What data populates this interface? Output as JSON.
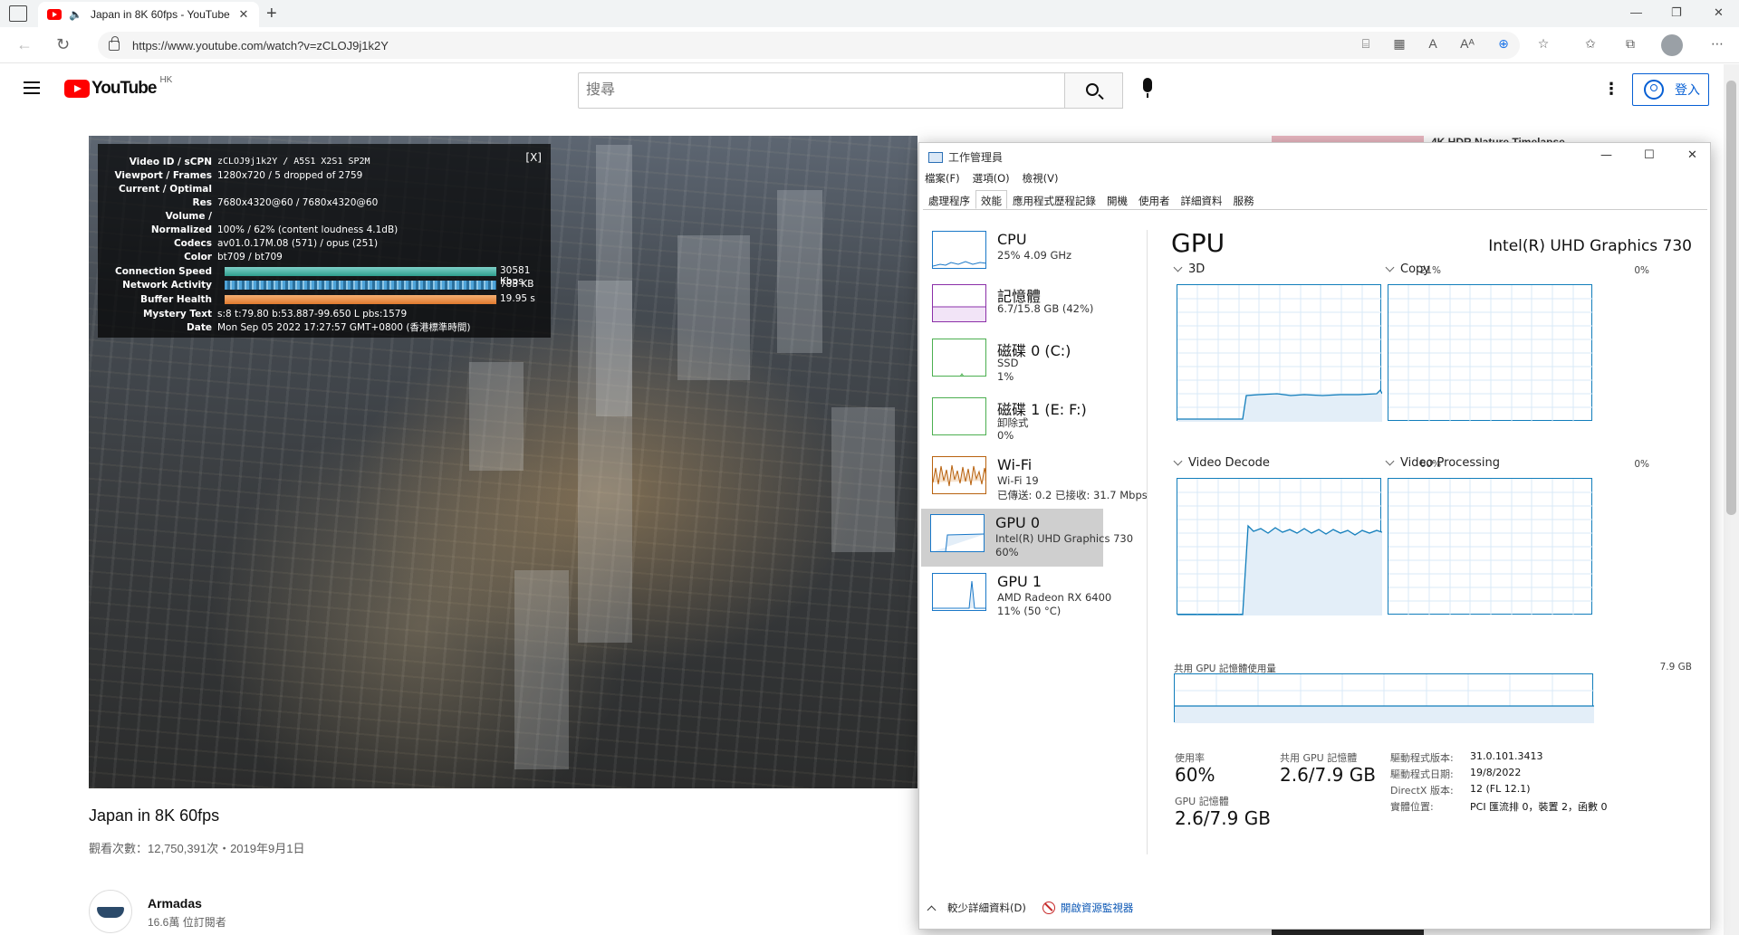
{
  "browser": {
    "tab_title": "Japan in 8K 60fps - YouTube",
    "url": "https://www.youtube.com/watch?v=zCLOJ9j1k2Y"
  },
  "youtube": {
    "logo_text": "YouTube",
    "country": "HK",
    "search_placeholder": "搜尋",
    "signin_label": "登入",
    "video": {
      "title": "Japan in 8K 60fps",
      "meta": "觀看次數：12,750,391次・2019年9月1日",
      "channel": "Armadas",
      "subscribers": "16.6萬 位訂閱者"
    },
    "related_title": "4K HDR Nature Timelapse"
  },
  "stats_for_nerds": {
    "close": "[X]",
    "rows": [
      {
        "k": "Video ID / sCPN",
        "v": "zCLOJ9j1k2Y / A5S1 X2S1 SP2M"
      },
      {
        "k": "Viewport / Frames",
        "v": "1280x720 / 5 dropped of 2759"
      },
      {
        "k": "Current / Optimal",
        "v": ""
      },
      {
        "k": "Res",
        "v": "7680x4320@60 / 7680x4320@60"
      },
      {
        "k": "Volume /",
        "v": ""
      },
      {
        "k": "Normalized",
        "v": "100% / 62% (content loudness 4.1dB)"
      },
      {
        "k": "Codecs",
        "v": "av01.0.17M.08 (571) / opus (251)"
      },
      {
        "k": "Color",
        "v": "bt709 / bt709"
      },
      {
        "k": "Connection Speed",
        "v": ""
      },
      {
        "k": "Network Activity",
        "v": ""
      },
      {
        "k": "Buffer Health",
        "v": ""
      },
      {
        "k": "Mystery Text",
        "v": "s:8 t:79.80 b:53.887-99.650 L pbs:1579"
      },
      {
        "k": "Date",
        "v": "Mon Sep 05 2022 17:27:57 GMT+0800 (香港標準時間)"
      }
    ],
    "connection_speed": "30581 Kbps",
    "network_activity": "783 KB",
    "buffer_health": "19.95 s"
  },
  "task_manager": {
    "title": "工作管理員",
    "menu": [
      "檔案(F)",
      "選項(O)",
      "檢視(V)"
    ],
    "tabs": [
      "處理程序",
      "效能",
      "應用程式歷程記錄",
      "開機",
      "使用者",
      "詳細資料",
      "服務"
    ],
    "active_tab": "效能",
    "resources": [
      {
        "name": "CPU",
        "l2": "25% 4.09 GHz",
        "l3": ""
      },
      {
        "name": "記憶體",
        "l2": "6.7/15.8 GB (42%)",
        "l3": ""
      },
      {
        "name": "磁碟 0 (C:)",
        "l2": "SSD",
        "l3": "1%"
      },
      {
        "name": "磁碟 1 (E: F:)",
        "l2": "卸除式",
        "l3": "0%"
      },
      {
        "name": "Wi-Fi",
        "l2": "Wi-Fi 19",
        "l3": "已傳送: 0.2 已接收: 31.7 Mbps"
      },
      {
        "name": "GPU 0",
        "l2": "Intel(R) UHD Graphics 730",
        "l3": "60%"
      },
      {
        "name": "GPU 1",
        "l2": "AMD Radeon RX 6400",
        "l3": "11% (50 °C)"
      }
    ],
    "selected_resource": "GPU 0",
    "detail": {
      "heading": "GPU",
      "model": "Intel(R) UHD Graphics 730",
      "engines": [
        {
          "name": "3D",
          "pct": "21%"
        },
        {
          "name": "Copy",
          "pct": "0%"
        },
        {
          "name": "Video Decode",
          "pct": "60%"
        },
        {
          "name": "Video Processing",
          "pct": "0%"
        }
      ],
      "shared_mem_label": "共用 GPU 記憶體使用量",
      "shared_mem_max": "7.9 GB",
      "utilization_label": "使用率",
      "utilization": "60%",
      "shared_mem_stat_label": "共用 GPU 記憶體",
      "shared_mem_stat": "2.6/7.9 GB",
      "gpu_mem_label": "GPU 記憶體",
      "gpu_mem": "2.6/7.9 GB",
      "info": [
        {
          "k": "驅動程式版本:",
          "v": "31.0.101.3413"
        },
        {
          "k": "驅動程式日期:",
          "v": "19/8/2022"
        },
        {
          "k": "DirectX 版本:",
          "v": "12 (FL 12.1)"
        },
        {
          "k": "實體位置:",
          "v": "PCI 匯流排 0，裝置 2，函數 0"
        }
      ]
    },
    "footer": {
      "fewer_details": "較少詳細資料(D)",
      "open_resmon": "開啟資源監視器"
    }
  }
}
